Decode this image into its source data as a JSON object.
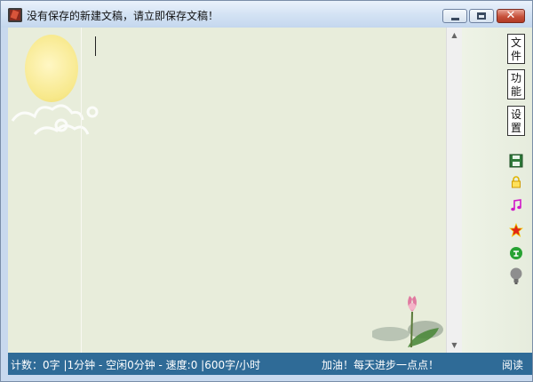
{
  "window": {
    "title": "没有保存的新建文稿，请立即保存文稿！",
    "buttons": {
      "minimize": "minimize",
      "maximize": "maximize",
      "close": "✕"
    }
  },
  "sidebar": {
    "file": [
      "文",
      "件"
    ],
    "function": [
      "功",
      "能"
    ],
    "settings": [
      "设",
      "置"
    ],
    "icons": [
      "save-icon",
      "lock-icon",
      "music-icon",
      "star-icon",
      "rank-icon",
      "bulb-icon"
    ]
  },
  "statusbar": {
    "left": "计数：0字 |1分钟 - 空闲0分钟 - 速度:0 |600字/小时",
    "right": "加油！每天进步一点点！",
    "cut": "阅读"
  },
  "colors": {
    "editor_bg": "#e8eddb",
    "status_bg": "#2f6b97",
    "close_red": "#c7513b"
  }
}
